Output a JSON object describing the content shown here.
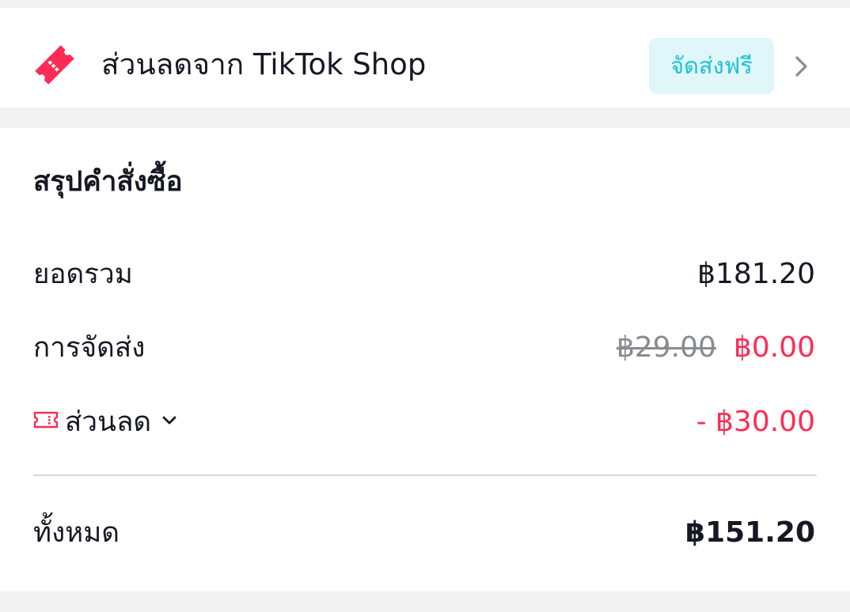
{
  "voucher": {
    "icon": "ticket-icon",
    "title": "ส่วนลดจาก TikTok Shop",
    "badge": "จัดส่งฟรี",
    "chevron_icon": "chevron-right-icon"
  },
  "order_summary": {
    "title": "สรุปคำสั่งซื้อ",
    "subtotal_label": "ยอดรวม",
    "subtotal_value": "฿181.20",
    "shipping_label": "การจัดส่ง",
    "shipping_original": "฿29.00",
    "shipping_value": "฿0.00",
    "discount_label": "ส่วนลด",
    "discount_icon": "ticket-icon",
    "discount_expand_icon": "chevron-down-icon",
    "discount_value": "- ฿30.00",
    "total_label": "ทั้งหมด",
    "total_value": "฿151.20"
  },
  "colors": {
    "accent": "#fe2c55",
    "badge_text": "#1cc3d6",
    "badge_background": "#e0f6f8",
    "strikethrough": "#8a8b91",
    "text": "#161823",
    "page_background": "#f2f2f2"
  }
}
